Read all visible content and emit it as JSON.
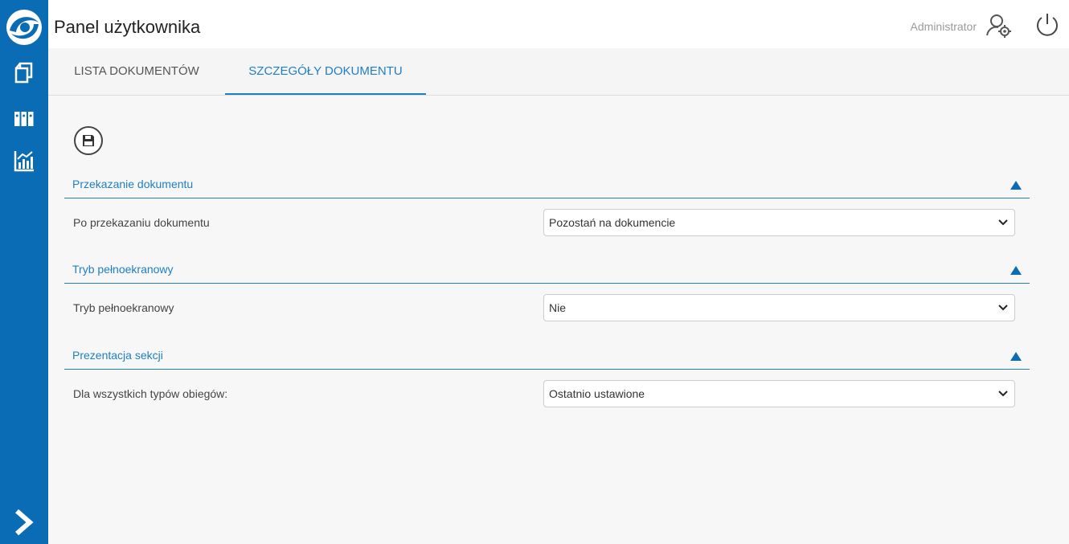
{
  "app": {
    "title": "Panel użytkownika",
    "user": "Administrator",
    "accent": "#0a6cb4",
    "link_color": "#1f7ec5"
  },
  "sidebar": {
    "icons": [
      "logo-icon",
      "documents-icon",
      "binders-icon",
      "statistics-icon",
      "expand-chevron-icon"
    ]
  },
  "header": {
    "icons": [
      "user-settings-icon",
      "power-icon"
    ]
  },
  "tabs": [
    {
      "label": "LISTA DOKUMENTÓW",
      "active": false
    },
    {
      "label": "SZCZEGÓŁY DOKUMENTU",
      "active": true
    }
  ],
  "toolbar": {
    "icons": [
      "save-icon"
    ]
  },
  "sections": [
    {
      "title": "Przekazanie dokumentu",
      "field_label": "Po przekazaniu dokumentu",
      "value": "Pozostań na dokumencie"
    },
    {
      "title": "Tryb pełnoekranowy",
      "field_label": "Tryb pełnoekranowy",
      "value": "Nie"
    },
    {
      "title": "Prezentacja sekcji",
      "field_label": "Dla wszystkich typów obiegów:",
      "value": "Ostatnio ustawione"
    }
  ]
}
